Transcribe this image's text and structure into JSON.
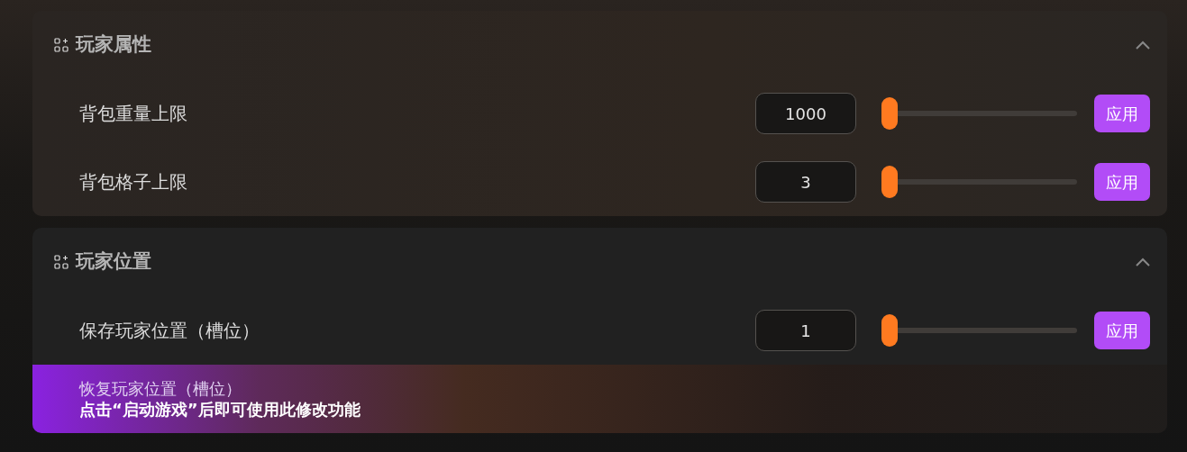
{
  "sections": [
    {
      "title": "玩家属性",
      "expanded": true,
      "rows": [
        {
          "label": "背包重量上限",
          "value": "1000",
          "level": 0,
          "button": "应用",
          "locked": false
        },
        {
          "label": "背包格子上限",
          "value": "3",
          "level": 0,
          "button": "应用",
          "locked": false
        }
      ]
    },
    {
      "title": "玩家位置",
      "expanded": true,
      "rows": [
        {
          "label": "保存玩家位置（槽位）",
          "value": "1",
          "level": 0,
          "button": "应用",
          "locked": false
        },
        {
          "label": "恢复玩家位置（槽位）",
          "locked": true,
          "notice": "点击“启动游戏”后即可使用此修改功能"
        }
      ]
    }
  ]
}
